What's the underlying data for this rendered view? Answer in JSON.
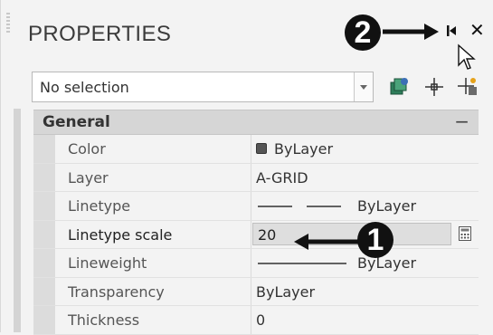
{
  "header": {
    "title": "PROPERTIES"
  },
  "badges": {
    "pin_badge": "2",
    "scale_badge": "1"
  },
  "selector": {
    "value": "No selection"
  },
  "toolbar": {
    "icons": [
      "quick-select-icon",
      "select-objects-icon",
      "toggle-pickadd-icon"
    ]
  },
  "section": {
    "title": "General",
    "toggle": "−"
  },
  "properties": [
    {
      "name": "Color",
      "value": "ByLayer"
    },
    {
      "name": "Layer",
      "value": "A-GRID"
    },
    {
      "name": "Linetype",
      "value": "ByLayer"
    },
    {
      "name": "Linetype scale",
      "value": "20"
    },
    {
      "name": "Lineweight",
      "value": "ByLayer"
    },
    {
      "name": "Transparency",
      "value": "ByLayer"
    },
    {
      "name": "Thickness",
      "value": "0"
    }
  ],
  "colors": {
    "badge_bg": "#111111",
    "panel_bg": "#f3f3f3",
    "section_bg": "#d6d6d6"
  }
}
